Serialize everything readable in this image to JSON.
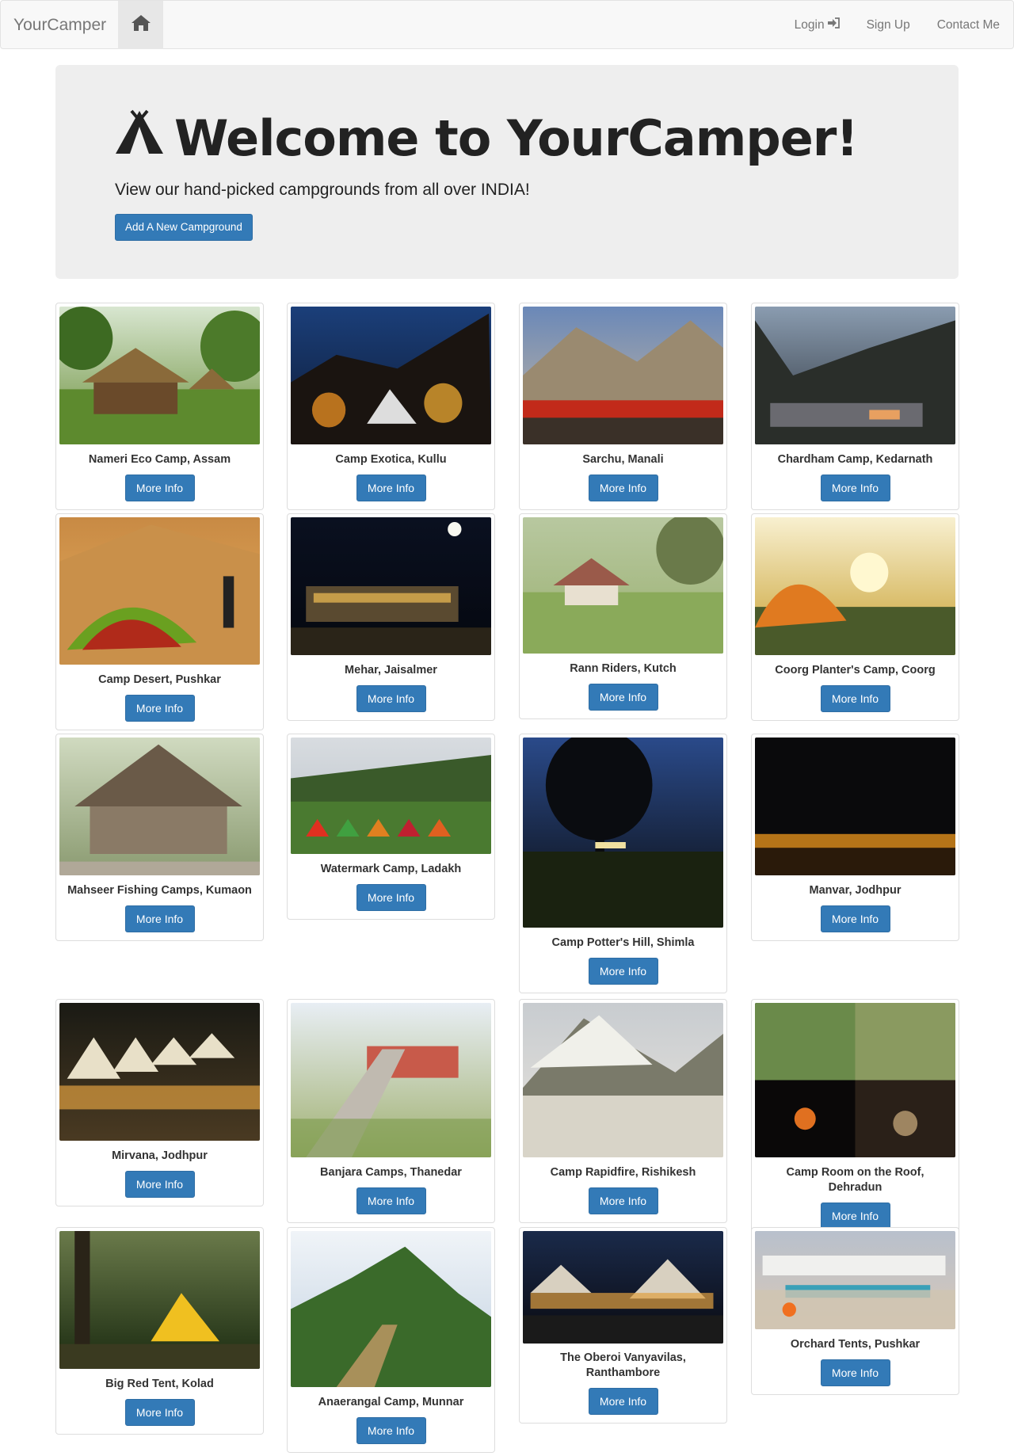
{
  "nav": {
    "brand": "YourCamper",
    "login": "Login",
    "signup": "Sign Up",
    "contact": "Contact Me"
  },
  "jumbotron": {
    "title": "Welcome to YourCamper!",
    "subtitle": "View our hand-picked campgrounds from all over INDIA!",
    "add_button": "Add A New Campground"
  },
  "more_info_label": "More Info",
  "campgrounds": [
    {
      "name": "Nameri Eco Camp, Assam",
      "scene": "forest-huts"
    },
    {
      "name": "Camp Exotica, Kullu",
      "scene": "night-tent"
    },
    {
      "name": "Sarchu, Manali",
      "scene": "mountain-tents"
    },
    {
      "name": "Chardham Camp, Kedarnath",
      "scene": "misty-mountain"
    },
    {
      "name": "Camp Desert, Pushkar",
      "scene": "desert-tent"
    },
    {
      "name": "Mehar, Jaisalmer",
      "scene": "night-camp"
    },
    {
      "name": "Rann Riders, Kutch",
      "scene": "cottages"
    },
    {
      "name": "Coorg Planter's Camp, Coorg",
      "scene": "sunset-tent"
    },
    {
      "name": "Mahseer Fishing Camps, Kumaon",
      "scene": "forest-shelter"
    },
    {
      "name": "Watermark Camp, Ladakh",
      "scene": "meadow-tents"
    },
    {
      "name": "Camp Potter's Hill, Shimla",
      "scene": "night-tree"
    },
    {
      "name": "Manvar, Jodhpur",
      "scene": "desert-night"
    },
    {
      "name": "Mirvana, Jodhpur",
      "scene": "lit-tents"
    },
    {
      "name": "Banjara Camps, Thanedar",
      "scene": "hill-walkway"
    },
    {
      "name": "Camp Rapidfire, Rishikesh",
      "scene": "beach-canopy"
    },
    {
      "name": "Camp Room on the Roof, Dehradun",
      "scene": "collage"
    },
    {
      "name": "Big Red Tent, Kolad",
      "scene": "forest-tent"
    },
    {
      "name": "Anaerangal Camp, Munnar",
      "scene": "green-hill"
    },
    {
      "name": "The Oberoi Vanyavilas, Ranthambore",
      "scene": "luxury-tents"
    },
    {
      "name": "Orchard Tents, Pushkar",
      "scene": "dusk-tents"
    }
  ],
  "colors": {
    "primary": "#337ab7",
    "navbar_bg": "#f8f8f8",
    "jumbotron_bg": "#eeeeee"
  }
}
